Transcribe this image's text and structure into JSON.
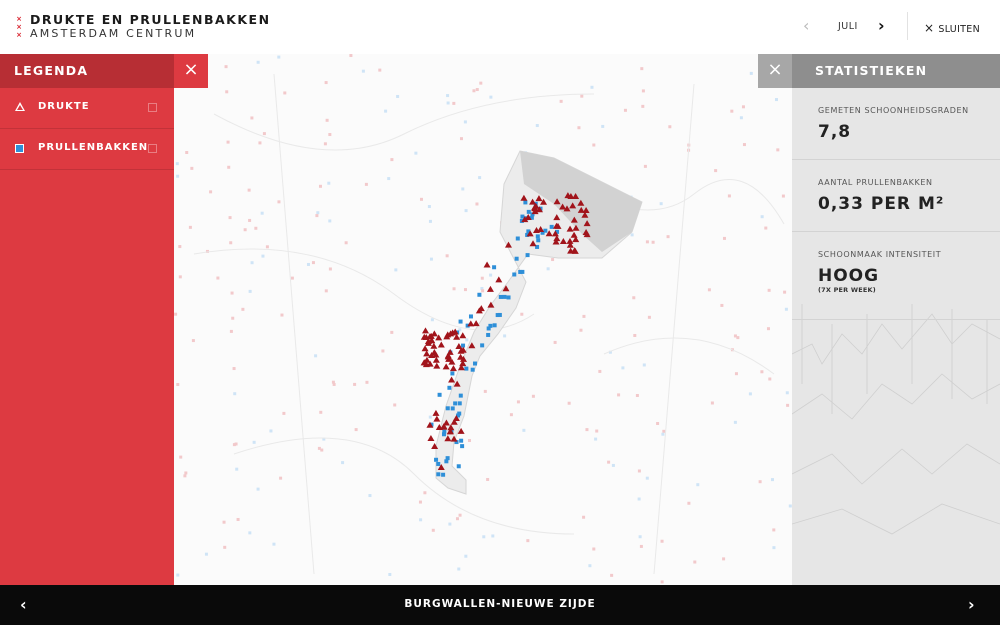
{
  "header": {
    "title": "DRUKTE EN PRULLENBAKKEN",
    "subtitle": "AMSTERDAM CENTRUM",
    "logo_marks": [
      "×",
      "×",
      "×"
    ],
    "month": "JULI",
    "prev_icon": "‹",
    "next_icon": "›",
    "close_label": "SLUITEN",
    "close_icon": "×"
  },
  "legend": {
    "title": "LEGENDA",
    "close_icon": "×",
    "items": [
      {
        "label": "DRUKTE",
        "icon": "triangle-icon"
      },
      {
        "label": "PRULLENBAKKEN",
        "icon": "square-icon"
      }
    ]
  },
  "stats": {
    "title": "STATISTIEKEN",
    "close_icon": "×",
    "blocks": [
      {
        "label": "GEMETEN SCHOONHEIDSGRADEN",
        "value": "7,8",
        "note": ""
      },
      {
        "label": "AANTAL PRULLENBAKKEN",
        "value": "0,33 PER M²",
        "note": ""
      },
      {
        "label": "SCHOONMAAK INTENSITEIT",
        "value": "HOOG",
        "note": "(7X PER WEEK)"
      }
    ]
  },
  "footer": {
    "title": "BURGWALLEN-NIEUWE ZIJDE",
    "prev_icon": "‹",
    "next_icon": "›"
  },
  "colors": {
    "accent_red": "#dd3a41",
    "dark_red": "#b72e34",
    "crowd_marker": "#a1141b",
    "bin_marker": "#2e8fd8",
    "stats_gray": "#8e8e8e"
  }
}
